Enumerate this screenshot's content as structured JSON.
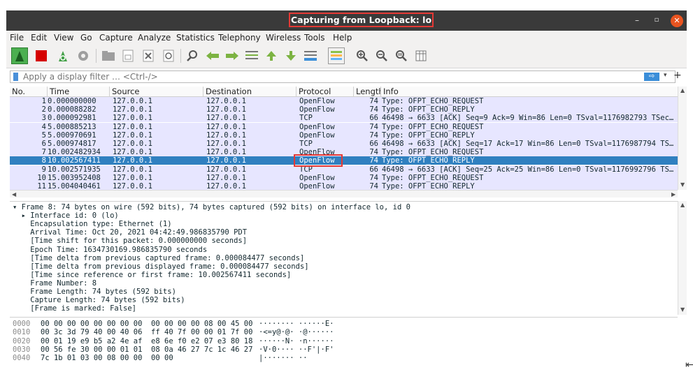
{
  "window": {
    "title": "Capturing from Loopback: lo",
    "min_glyph": "–",
    "max_glyph": "▫",
    "close_glyph": "✕"
  },
  "menu": [
    "File",
    "Edit",
    "View",
    "Go",
    "Capture",
    "Analyze",
    "Statistics",
    "Telephony",
    "Wireless",
    "Tools",
    "Help"
  ],
  "filter": {
    "placeholder": "Apply a display filter … <Ctrl-/>",
    "apply_glyph": "⇨",
    "dropdown_glyph": "▾",
    "add_glyph": "+"
  },
  "columns": [
    "No.",
    "Time",
    "Source",
    "Destination",
    "Protocol",
    "Length",
    "Info"
  ],
  "packets": [
    {
      "no": "1",
      "time": "0.000000000",
      "src": "127.0.0.1",
      "dst": "127.0.0.1",
      "proto": "OpenFlow",
      "len": "74",
      "info": "Type: OFPT_ECHO_REQUEST"
    },
    {
      "no": "2",
      "time": "0.000088282",
      "src": "127.0.0.1",
      "dst": "127.0.0.1",
      "proto": "OpenFlow",
      "len": "74",
      "info": "Type: OFPT_ECHO_REPLY"
    },
    {
      "no": "3",
      "time": "0.000092981",
      "src": "127.0.0.1",
      "dst": "127.0.0.1",
      "proto": "TCP",
      "len": "66",
      "info": "46498 → 6633 [ACK] Seq=9 Ack=9 Win=86 Len=0 TSval=1176982793 TSec…"
    },
    {
      "no": "4",
      "time": "5.000885213",
      "src": "127.0.0.1",
      "dst": "127.0.0.1",
      "proto": "OpenFlow",
      "len": "74",
      "info": "Type: OFPT_ECHO_REQUEST"
    },
    {
      "no": "5",
      "time": "5.000970691",
      "src": "127.0.0.1",
      "dst": "127.0.0.1",
      "proto": "OpenFlow",
      "len": "74",
      "info": "Type: OFPT_ECHO_REPLY"
    },
    {
      "no": "6",
      "time": "5.000974817",
      "src": "127.0.0.1",
      "dst": "127.0.0.1",
      "proto": "TCP",
      "len": "66",
      "info": "46498 → 6633 [ACK] Seq=17 Ack=17 Win=86 Len=0 TSval=1176987794 TS…"
    },
    {
      "no": "7",
      "time": "10.002482934",
      "src": "127.0.0.1",
      "dst": "127.0.0.1",
      "proto": "OpenFlow",
      "len": "74",
      "info": "Type: OFPT_ECHO_REQUEST"
    },
    {
      "no": "8",
      "time": "10.002567411",
      "src": "127.0.0.1",
      "dst": "127.0.0.1",
      "proto": "OpenFlow",
      "len": "74",
      "info": "Type: OFPT_ECHO_REPLY",
      "selected": true
    },
    {
      "no": "9",
      "time": "10.002571935",
      "src": "127.0.0.1",
      "dst": "127.0.0.1",
      "proto": "TCP",
      "len": "66",
      "info": "46498 → 6633 [ACK] Seq=25 Ack=25 Win=86 Len=0 TSval=1176992796 TS…"
    },
    {
      "no": "10",
      "time": "15.003952408",
      "src": "127.0.0.1",
      "dst": "127.0.0.1",
      "proto": "OpenFlow",
      "len": "74",
      "info": "Type: OFPT_ECHO_REQUEST"
    },
    {
      "no": "11",
      "time": "15.004040461",
      "src": "127.0.0.1",
      "dst": "127.0.0.1",
      "proto": "OpenFlow",
      "len": "74",
      "info": "Type: OFPT_ECHO_REPLY"
    }
  ],
  "details": [
    "▾ Frame 8: 74 bytes on wire (592 bits), 74 bytes captured (592 bits) on interface lo, id 0",
    "  ▸ Interface id: 0 (lo)",
    "    Encapsulation type: Ethernet (1)",
    "    Arrival Time: Oct 20, 2021 04:42:49.986835790 PDT",
    "    [Time shift for this packet: 0.000000000 seconds]",
    "    Epoch Time: 1634730169.986835790 seconds",
    "    [Time delta from previous captured frame: 0.000084477 seconds]",
    "    [Time delta from previous displayed frame: 0.000084477 seconds]",
    "    [Time since reference or first frame: 10.002567411 seconds]",
    "    Frame Number: 8",
    "    Frame Length: 74 bytes (592 bits)",
    "    Capture Length: 74 bytes (592 bits)",
    "    [Frame is marked: False]"
  ],
  "bytes": [
    {
      "off": "0000",
      "hex": "00 00 00 00 00 00 00 00  00 00 00 00 08 00 45 00",
      "ascii": "········ ······E·"
    },
    {
      "off": "0010",
      "hex": "00 3c 3d 79 40 00 40 06  ff 40 7f 00 00 01 7f 00",
      "ascii": "·<=y@·@· ·@······"
    },
    {
      "off": "0020",
      "hex": "00 01 19 e9 b5 a2 4e af  e8 6e f0 e2 07 e3 80 18",
      "ascii": "······N· ·n······"
    },
    {
      "off": "0030",
      "hex": "00 56 fe 30 00 00 01 01  08 0a 46 27 7c 1c 46 27",
      "ascii": "·V·0···· ··F'|·F'"
    },
    {
      "off": "0040",
      "hex": "7c 1b 01 03 00 08 00 00  00 00",
      "ascii": "|······· ··"
    }
  ],
  "colors": {
    "selected_row": "#3080c0",
    "row_bg": "#e7e6ff",
    "highlight_box": "#e53935",
    "title_bg": "#3a3a3a"
  }
}
